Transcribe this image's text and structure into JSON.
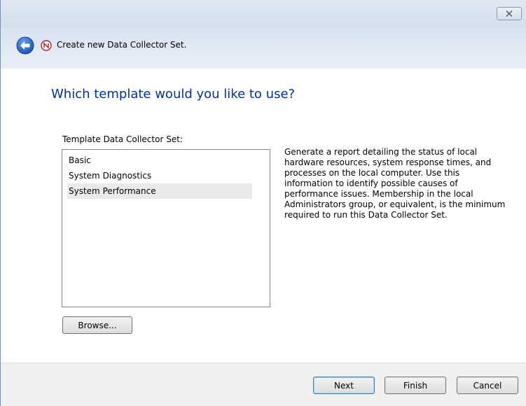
{
  "window": {
    "title": "Create new Data Collector Set.",
    "close_icon": "close-icon",
    "back_icon": "back-arrow-icon",
    "app_icon": "data-collector-icon"
  },
  "page": {
    "heading": "Which template would you like to use?",
    "list_label": "Template Data Collector Set:"
  },
  "templates": [
    {
      "label": "Basic",
      "selected": false
    },
    {
      "label": "System Diagnostics",
      "selected": false
    },
    {
      "label": "System Performance",
      "selected": true
    }
  ],
  "description": "Generate a report detailing the status of local hardware resources, system response times, and processes on the local computer. Use this information to identify possible causes of performance issues. Membership in the local Administrators group, or equivalent, is the minimum required to run this Data Collector Set.",
  "buttons": {
    "browse": "Browse...",
    "next": "Next",
    "finish": "Finish",
    "cancel": "Cancel"
  },
  "colors": {
    "heading": "#003399",
    "selection": "#eaeaea",
    "back_button": "#2e6fd1"
  }
}
